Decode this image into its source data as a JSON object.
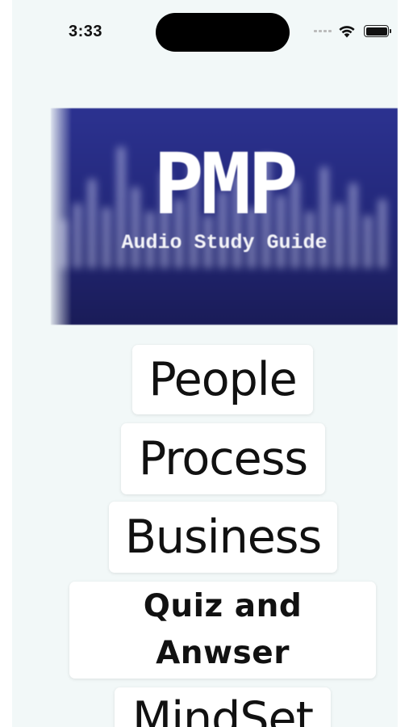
{
  "status_bar": {
    "time": "3:33",
    "icons": [
      "signal-dots-icon",
      "wifi-icon",
      "battery-icon"
    ]
  },
  "banner": {
    "title": "PMP",
    "subtitle": "Audio Study Guide",
    "colors": {
      "top": "#2c3290",
      "bottom": "#1a1c58",
      "text": "#ffffff"
    }
  },
  "menu": {
    "items": [
      {
        "label": "People"
      },
      {
        "label": "Process"
      },
      {
        "label": "Business"
      },
      {
        "label": "Quiz and\nAnwser"
      },
      {
        "label": "MindSet"
      }
    ]
  },
  "theme": {
    "background": "#f2f8f8",
    "button_background": "#ffffff",
    "text": "#111111"
  }
}
